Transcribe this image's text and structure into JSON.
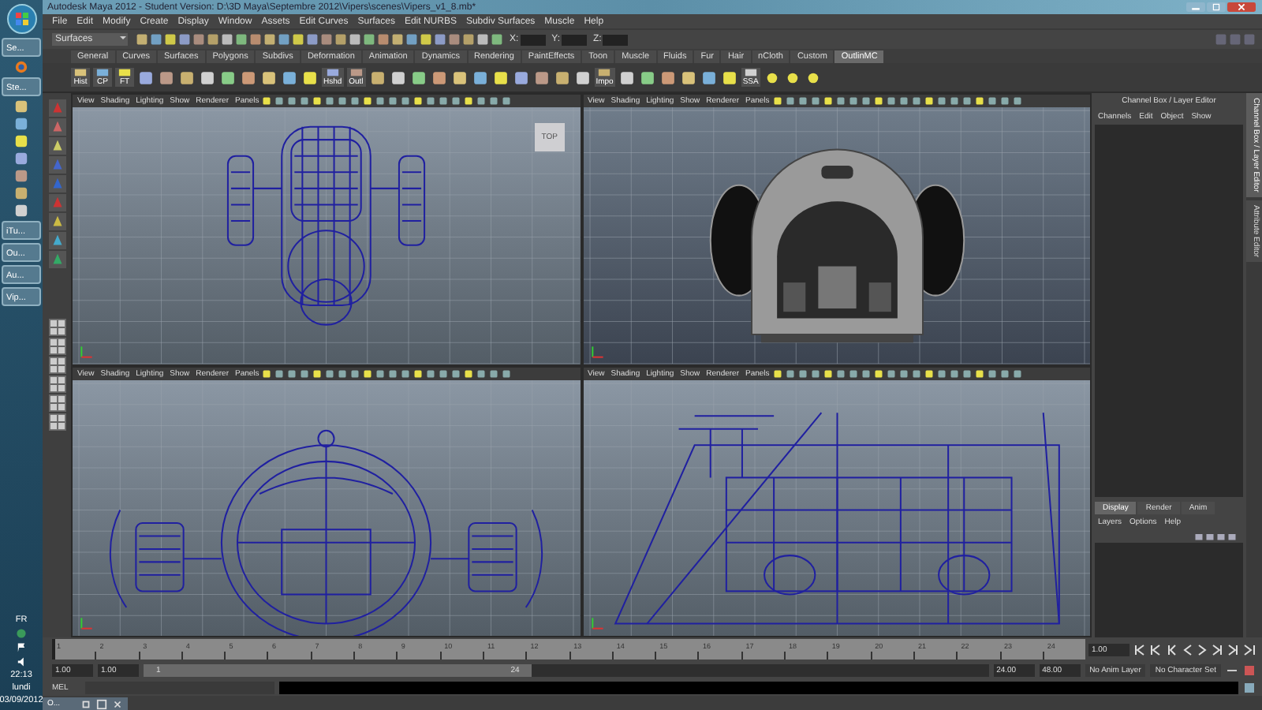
{
  "taskbar": {
    "items": [
      {
        "label": "Se..."
      },
      {
        "label": "Ste..."
      },
      {
        "label": "iTu..."
      },
      {
        "label": "Ou..."
      },
      {
        "label": "Au..."
      },
      {
        "label": "Vip..."
      }
    ],
    "tray": {
      "language": "FR",
      "time": "22:13",
      "day": "lundi",
      "date": "03/09/2012"
    }
  },
  "window": {
    "title": "Autodesk Maya 2012 - Student Version: D:\\3D Maya\\Septembre 2012\\Vipers\\scenes\\Vipers_v1_8.mb*"
  },
  "menu_bar": [
    "File",
    "Edit",
    "Modify",
    "Create",
    "Display",
    "Window",
    "Assets",
    "Edit Curves",
    "Surfaces",
    "Edit NURBS",
    "Subdiv Surfaces",
    "Muscle",
    "Help"
  ],
  "status_line": {
    "mode": "Surfaces",
    "fields": [
      {
        "label": "X:"
      },
      {
        "label": "Y:"
      },
      {
        "label": "Z:"
      }
    ]
  },
  "shelf": {
    "tabs": [
      {
        "label": "General",
        "selected": false
      },
      {
        "label": "Curves",
        "selected": false
      },
      {
        "label": "Surfaces",
        "selected": false
      },
      {
        "label": "Polygons",
        "selected": false
      },
      {
        "label": "Subdivs",
        "selected": false
      },
      {
        "label": "Deformation",
        "selected": false
      },
      {
        "label": "Animation",
        "selected": false
      },
      {
        "label": "Dynamics",
        "selected": false
      },
      {
        "label": "Rendering",
        "selected": false
      },
      {
        "label": "PaintEffects",
        "selected": false
      },
      {
        "label": "Toon",
        "selected": false
      },
      {
        "label": "Muscle",
        "selected": false
      },
      {
        "label": "Fluids",
        "selected": false
      },
      {
        "label": "Fur",
        "selected": false
      },
      {
        "label": "Hair",
        "selected": false
      },
      {
        "label": "nCloth",
        "selected": false
      },
      {
        "label": "Custom",
        "selected": false
      },
      {
        "label": "OutlinMC",
        "selected": true
      }
    ],
    "buttons": [
      {
        "label": "Hist"
      },
      {
        "label": "CP"
      },
      {
        "label": "FT"
      },
      {
        "label": "Hshd"
      },
      {
        "label": "Outl"
      },
      {
        "label": "Impo"
      },
      {
        "label": "SSA"
      }
    ]
  },
  "viewports": [
    {
      "kind": "top",
      "menus": [
        "View",
        "Shading",
        "Lighting",
        "Show",
        "Renderer",
        "Panels"
      ],
      "camera_label": "TOP"
    },
    {
      "kind": "shaded",
      "menus": [
        "View",
        "Shading",
        "Lighting",
        "Show",
        "Renderer",
        "Panels"
      ]
    },
    {
      "kind": "front",
      "menus": [
        "View",
        "Shading",
        "Lighting",
        "Show",
        "Renderer",
        "Panels"
      ]
    },
    {
      "kind": "side",
      "menus": [
        "View",
        "Shading",
        "Lighting",
        "Show",
        "Renderer",
        "Panels"
      ]
    }
  ],
  "channel_box": {
    "title": "Channel Box / Layer Editor",
    "menus": [
      "Channels",
      "Edit",
      "Object",
      "Show"
    ],
    "layer_tabs": [
      {
        "label": "Display",
        "selected": true
      },
      {
        "label": "Render",
        "selected": false
      },
      {
        "label": "Anim",
        "selected": false
      }
    ],
    "layer_menus": [
      "Layers",
      "Options",
      "Help"
    ]
  },
  "side_tabs": [
    {
      "label": "Channel Box / Layer Editor",
      "selected": true
    },
    {
      "label": "Attribute Editor",
      "selected": false
    }
  ],
  "time_slider": {
    "ticks": [
      "1",
      "2",
      "3",
      "4",
      "5",
      "6",
      "7",
      "8",
      "9",
      "10",
      "11",
      "12",
      "13",
      "14",
      "15",
      "16",
      "17",
      "18",
      "19",
      "20",
      "21",
      "22",
      "23",
      "24"
    ],
    "current_frame": "1.00",
    "level": 0
  },
  "range_slider": {
    "start": "1.00",
    "inner_start": "1.00",
    "range_start": "1",
    "range_end": "24",
    "level": 0.46,
    "inner_end": "24.00",
    "end": "48.00",
    "anim_layer": "No Anim Layer",
    "character_set": "No Character Set"
  },
  "command_line": {
    "language": "MEL"
  },
  "minimized_window": {
    "label": "O..."
  }
}
